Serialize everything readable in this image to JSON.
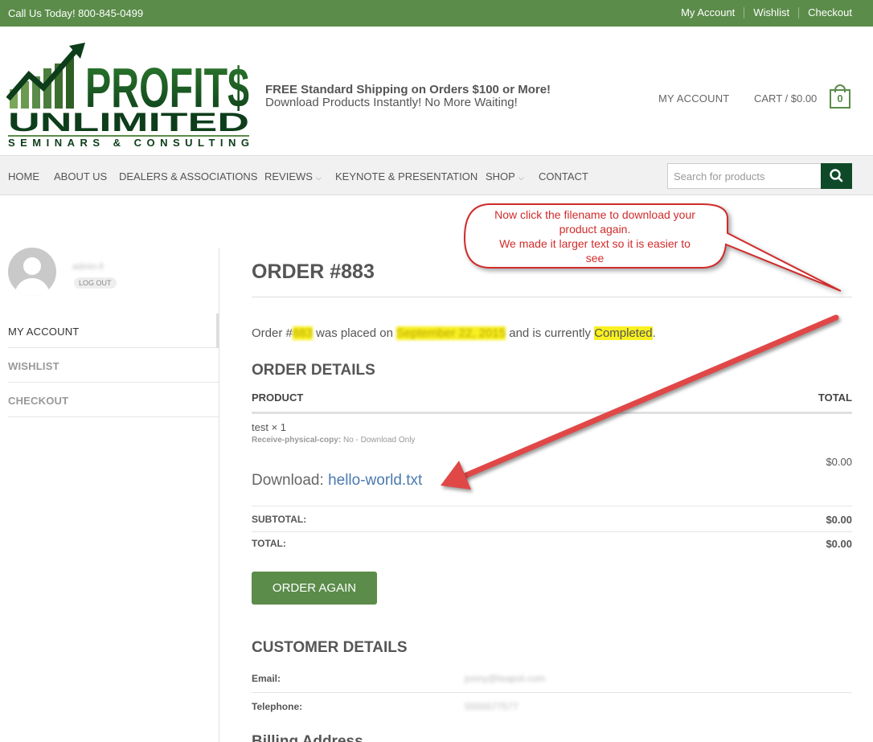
{
  "topbar": {
    "phone": "Call Us Today! 800-845-0499",
    "links": [
      "My Account",
      "Wishlist",
      "Checkout"
    ]
  },
  "header": {
    "logo": {
      "word1": "PROFIT$",
      "word2": "UNLIMITED",
      "word3": "SEMINARS & CONSULTING"
    },
    "tagline_1": "FREE Standard Shipping on Orders $100 or More!",
    "tagline_2": "Download Products Instantly! No More Waiting!",
    "account_link": "MY ACCOUNT",
    "cart_link": "CART / $0.00",
    "cart_count": "0"
  },
  "nav": {
    "items": [
      "HOME",
      "ABOUT US",
      "DEALERS & ASSOCIATIONS",
      "REVIEWS",
      "KEYNOTE & PRESENTATION",
      "SHOP",
      "CONTACT"
    ],
    "search_placeholder": "Search for products"
  },
  "sidebar": {
    "username": "admin-ll",
    "logout": "LOG OUT",
    "menu": [
      "MY ACCOUNT",
      "WISHLIST",
      "CHECKOUT"
    ]
  },
  "order": {
    "title": "ORDER #883",
    "summary_prefix": "Order #",
    "order_number": "883",
    "summary_mid": " was placed on ",
    "date": "September 22, 2015",
    "summary_mid2": " and is currently ",
    "status": "Completed",
    "summary_end": ".",
    "details_title": "ORDER DETAILS",
    "col_product": "PRODUCT",
    "col_total": "TOTAL",
    "product_name": "test × 1",
    "meta_label": "Receive-physical-copy:",
    "meta_value": "No - Download Only",
    "product_total": "$0.00",
    "download_label": "Download: ",
    "download_file": "hello-world.txt",
    "subtotal_label": "SUBTOTAL:",
    "subtotal_value": "$0.00",
    "total_label": "TOTAL:",
    "total_value": "$0.00",
    "order_again": "ORDER AGAIN"
  },
  "customer": {
    "title": "CUSTOMER DETAILS",
    "email_label": "Email:",
    "email_value": "jonny@teapot.com",
    "phone_label": "Telephone:",
    "phone_value": "5555577577",
    "billing_title": "Billing Address"
  },
  "annotation": {
    "line1": "Now click the filename to download your",
    "line2": "product again.",
    "line3": "We made it larger text so it is easier to",
    "line4": "see"
  },
  "colors": {
    "brand_green": "#5b8c4a",
    "dark_green": "#0f4a28",
    "highlight": "#f8f020",
    "annotation_red": "#d12b2b"
  }
}
